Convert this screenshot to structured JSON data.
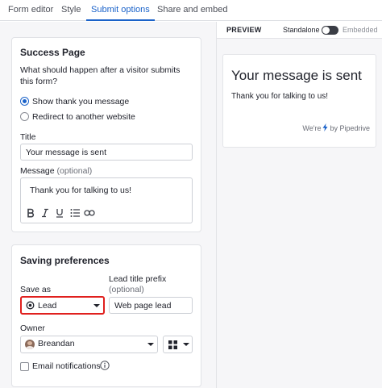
{
  "tabs": [
    "Form editor",
    "Style",
    "Submit options",
    "Share and embed"
  ],
  "active_tab": "Submit options",
  "success_page": {
    "heading": "Success Page",
    "question": "What should happen after a visitor submits this form?",
    "options": [
      "Show thank you message",
      "Redirect to another website"
    ],
    "selected": "Show thank you message",
    "title_label": "Title",
    "title_value": "Your message is sent",
    "message_label": "Message",
    "message_optional": "(optional)",
    "message_value": "Thank you for talking to us!",
    "toolbar_icons": [
      "bold-icon",
      "italic-icon",
      "underline-icon",
      "list-icon",
      "link-icon"
    ]
  },
  "saving": {
    "heading": "Saving preferences",
    "save_as_label": "Save as",
    "save_as_value": "Lead",
    "prefix_label": "Lead title prefix",
    "prefix_optional": "(optional)",
    "prefix_value": "Web page lead",
    "owner_label": "Owner",
    "owner_value": "Breandan",
    "email_notifications_label": "Email notifications",
    "email_notifications_checked": false
  },
  "preview": {
    "label": "PREVIEW",
    "standalone_label": "Standalone",
    "embedded_label": "Embedded",
    "title": "Your message is sent",
    "message": "Thank you for talking to us!",
    "brand_prefix": "We're",
    "brand_suffix": "by Pipedrive"
  },
  "colors": {
    "accent": "#1a62c9",
    "highlight": "#e0201e",
    "panel_bg": "#f6f6f8"
  }
}
